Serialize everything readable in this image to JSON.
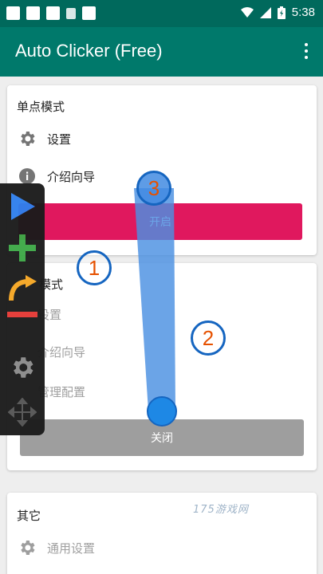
{
  "status_bar": {
    "time": "5:38"
  },
  "app_bar": {
    "title": "Auto Clicker (Free)",
    "menu_icon": "more-vert-icon"
  },
  "single_mode": {
    "title": "单点模式",
    "settings": "设置",
    "guide": "介绍向导",
    "start_button": "开启"
  },
  "multi_mode": {
    "title": "模式",
    "settings": "设置",
    "guide": "介绍向导",
    "manage": "管理配置",
    "close_button": "关闭"
  },
  "other": {
    "title": "其它",
    "general_settings": "通用设置"
  },
  "floating_toolbar": {
    "items": [
      "play-icon",
      "add-icon",
      "swipe-icon",
      "remove-icon",
      "settings-icon",
      "move-icon"
    ]
  },
  "markers": {
    "m1": "1",
    "m2": "2",
    "m3": "3"
  },
  "watermark": "175游戏网",
  "colors": {
    "status_bar": "#00695c",
    "app_bar": "#00796b",
    "start_button": "#e0185e",
    "close_button": "#9e9e9e",
    "marker_border": "#1565c0",
    "marker_number": "#e65100"
  }
}
